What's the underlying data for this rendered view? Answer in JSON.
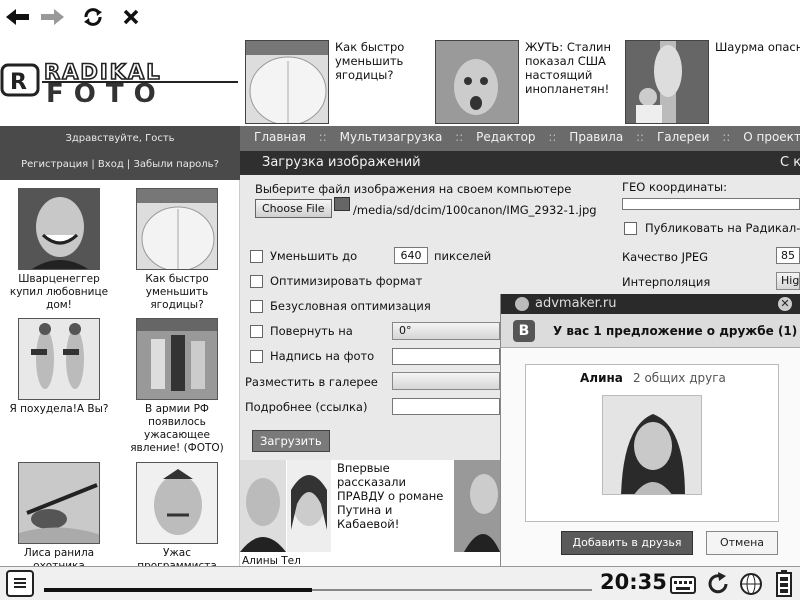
{
  "toolbar": {
    "back_icon": "arrow-left-icon",
    "forward_icon": "arrow-right-icon",
    "reload_icon": "reload-icon",
    "close_icon": "close-icon"
  },
  "site": {
    "logo_line1": "RADIKAL",
    "logo_line2": "FOTO"
  },
  "top_ads": [
    {
      "text": "Как быстро уменьшить ягодицы?"
    },
    {
      "text": "ЖУТЬ: Сталин показал США настоящий инопланетян!"
    },
    {
      "text": "Шаурма опасна"
    }
  ],
  "account": {
    "greeting": "Здравствуйте, Гость",
    "register": "Регистрация",
    "login": "Вход",
    "forgot": "Забыли пароль?",
    "sep": "|"
  },
  "nav": {
    "items": [
      "Главная",
      "Мультизагрузка",
      "Редактор",
      "Правила",
      "Галереи",
      "О проекте"
    ],
    "sep": "::"
  },
  "page": {
    "title": "Загрузка изображений",
    "title_right": "С к"
  },
  "sidebar": {
    "items": [
      {
        "caption": "Шварценеггер купил любовнице дом!"
      },
      {
        "caption": "Как быстро уменьшить ягодицы?"
      },
      {
        "caption": "Я похудела!А Вы?"
      },
      {
        "caption": "В армии РФ появилось ужасающее явление! (ФОТО)"
      },
      {
        "caption": "Лиса ранила охотника"
      },
      {
        "caption": "Ужас программиста"
      }
    ]
  },
  "form": {
    "file_prompt": "Выберите файл изображения на своем компьютере",
    "choose_file": "Choose File",
    "file_path": "/media/sd/dcim/100canon/IMG_2932-1.jpg",
    "geo_label": "ГЕО координаты:",
    "publish_label": "Публиковать на Радикал-Г",
    "resize_label": "Уменьшить до",
    "resize_value": "640",
    "resize_unit": "пикселей",
    "jpeg_label": "Качество JPEG",
    "jpeg_value": "85",
    "optimize_label": "Оптимизировать формат",
    "interp_label": "Интерполяция",
    "interp_value": "Hig",
    "uncond_label": "Безусловная оптимизация",
    "rotate_label": "Повернуть на",
    "rotate_value": "0°",
    "caption_label": "Надпись на фото",
    "gallery_label": "Разместить в галерее",
    "more_label": "Подробнее (ссылка)",
    "upload_button": "Загрузить"
  },
  "news": {
    "text": "Впервые рассказали ПРАВДУ о романе Путина и Кабаевой!",
    "footer": "Алины Тел"
  },
  "popup": {
    "brand": "advmaker.ru",
    "vk_letter": "B",
    "title": "У вас 1 предложение о дружбе (1)",
    "friend_name": "Алина",
    "mutual": "2 общих друга",
    "add_button": "Добавить в друзья",
    "cancel_button": "Отмена"
  },
  "taskbar": {
    "time": "20:35",
    "menu_icon": "menu-icon",
    "keyboard_icon": "keyboard-icon",
    "rotate_icon": "rotate-icon",
    "network_icon": "globe-icon",
    "battery_icon": "battery-icon"
  }
}
